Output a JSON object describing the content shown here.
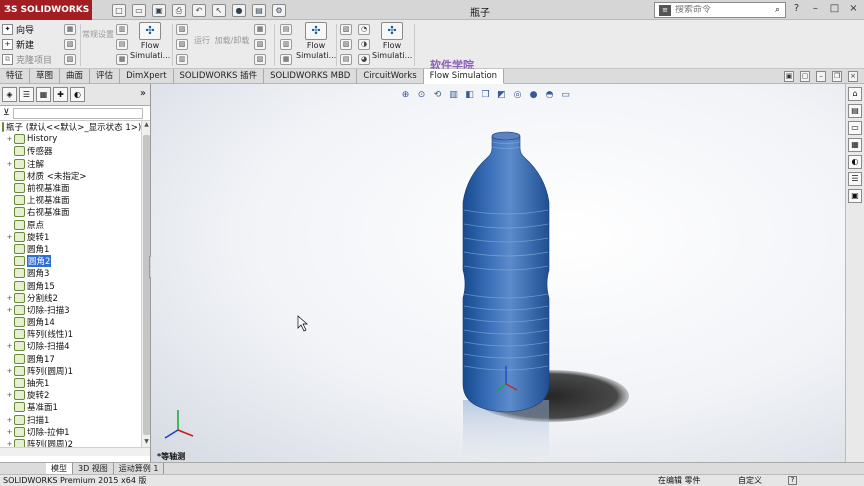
{
  "app": {
    "brand": "SOLIDWORKS",
    "doc_title": "瓶子",
    "status_app": "SOLIDWORKS Premium 2015 x64 版",
    "status_mode": "在编辑 零件",
    "status_custom": "自定义",
    "help_glyph": "?"
  },
  "search": {
    "placeholder": "搜索命令"
  },
  "ribbon": {
    "left": [
      "向导",
      "新建",
      "克隆项目"
    ],
    "groups": [
      {
        "label": "Flow Simulati...",
        "enabled": true
      },
      {
        "label": "常规设置",
        "enabled": false
      },
      {
        "label": "运行",
        "enabled": false
      },
      {
        "label": "加载/卸载",
        "enabled": false
      },
      {
        "label": "Flow Simulati...",
        "enabled": true
      },
      {
        "label": "Flow Simulati...",
        "enabled": true
      }
    ]
  },
  "watermark": "软件学院",
  "tabs": [
    "特征",
    "草图",
    "曲面",
    "评估",
    "DimXpert",
    "SOLIDWORKS 插件",
    "SOLIDWORKS MBD",
    "CircuitWorks",
    "Flow Simulation"
  ],
  "active_tab": "Flow Simulation",
  "tree": [
    {
      "label": "瓶子 (默认<<默认>_显示状态 1>)",
      "exp": "",
      "icon": "part-icon",
      "indent": 0
    },
    {
      "label": "History",
      "exp": "+",
      "icon": "history-icon",
      "indent": 1
    },
    {
      "label": "传感器",
      "exp": "",
      "icon": "sensor-icon",
      "indent": 1
    },
    {
      "label": "注解",
      "exp": "+",
      "icon": "annotation-icon",
      "indent": 1
    },
    {
      "label": "材质 <未指定>",
      "exp": "",
      "icon": "material-icon",
      "indent": 1
    },
    {
      "label": "前视基准面",
      "exp": "",
      "icon": "plane-icon",
      "indent": 1
    },
    {
      "label": "上视基准面",
      "exp": "",
      "icon": "plane-icon",
      "indent": 1
    },
    {
      "label": "右视基准面",
      "exp": "",
      "icon": "plane-icon",
      "indent": 1
    },
    {
      "label": "原点",
      "exp": "",
      "icon": "origin-icon",
      "indent": 1
    },
    {
      "label": "旋转1",
      "exp": "+",
      "icon": "revolve-icon",
      "indent": 1
    },
    {
      "label": "圆角1",
      "exp": "",
      "icon": "fillet-icon",
      "indent": 1
    },
    {
      "label": "圆角2",
      "exp": "",
      "icon": "fillet-icon",
      "indent": 1,
      "selected": true
    },
    {
      "label": "圆角3",
      "exp": "",
      "icon": "fillet-icon",
      "indent": 1
    },
    {
      "label": "圆角15",
      "exp": "",
      "icon": "fillet-icon",
      "indent": 1
    },
    {
      "label": "分割线2",
      "exp": "+",
      "icon": "split-line-icon",
      "indent": 1
    },
    {
      "label": "切除-扫描3",
      "exp": "+",
      "icon": "cut-sweep-icon",
      "indent": 1
    },
    {
      "label": "圆角14",
      "exp": "",
      "icon": "fillet-icon",
      "indent": 1
    },
    {
      "label": "阵列(线性)1",
      "exp": "",
      "icon": "linear-pattern-icon",
      "indent": 1
    },
    {
      "label": "切除-扫描4",
      "exp": "+",
      "icon": "cut-sweep-icon",
      "indent": 1
    },
    {
      "label": "圆角17",
      "exp": "",
      "icon": "fillet-icon",
      "indent": 1
    },
    {
      "label": "阵列(圆周)1",
      "exp": "+",
      "icon": "circular-pattern-icon",
      "indent": 1
    },
    {
      "label": "抽壳1",
      "exp": "",
      "icon": "shell-icon",
      "indent": 1
    },
    {
      "label": "旋转2",
      "exp": "+",
      "icon": "revolve-icon",
      "indent": 1
    },
    {
      "label": "基准面1",
      "exp": "",
      "icon": "plane-icon",
      "indent": 1
    },
    {
      "label": "扫描1",
      "exp": "+",
      "icon": "sweep-icon",
      "indent": 1
    },
    {
      "label": "切除-拉伸1",
      "exp": "+",
      "icon": "cut-extrude-icon",
      "indent": 1
    },
    {
      "label": "阵列(圆周)2",
      "exp": "+",
      "icon": "circular-pattern-icon",
      "indent": 1
    }
  ],
  "bottom_tabs": [
    "模型",
    "3D 视图",
    "运动算例 1"
  ],
  "view_label": "*等轴测",
  "colors": {
    "bottle": "#3a6fb8",
    "bottle_dark": "#174a8e",
    "shadow": "#141414",
    "brand_red": "#a31e22",
    "select_blue": "#2f6fd6"
  }
}
